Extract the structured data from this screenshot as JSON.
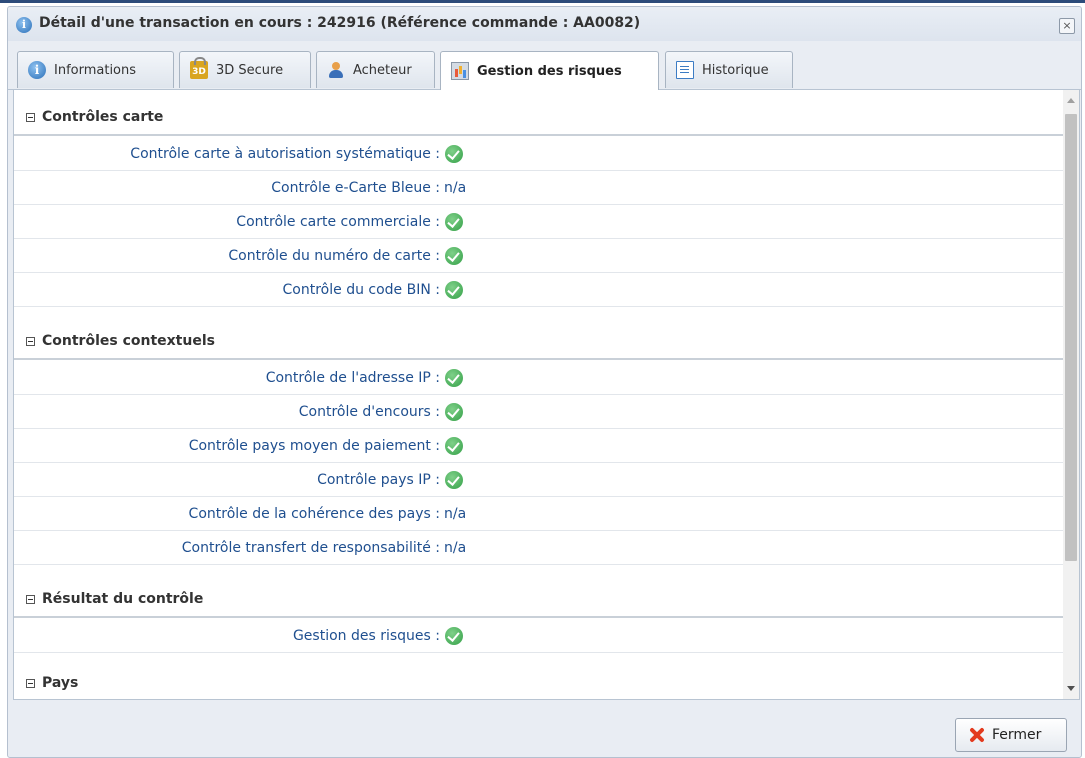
{
  "window": {
    "title": "Détail d'une transaction en cours : 242916 (Référence commande : AA0082)",
    "close_glyph": "×"
  },
  "tabs": [
    {
      "label": "Informations",
      "icon": "info-icon"
    },
    {
      "label": "3D Secure",
      "icon": "lock-3d-icon"
    },
    {
      "label": "Acheteur",
      "icon": "user-icon"
    },
    {
      "label": "Gestion des risques",
      "icon": "chart-icon",
      "active": true
    },
    {
      "label": "Historique",
      "icon": "document-icon"
    }
  ],
  "sections": [
    {
      "title": "Contrôles carte",
      "rows": [
        {
          "label": "Contrôle carte à autorisation systématique :",
          "value": "check"
        },
        {
          "label": "Contrôle e-Carte Bleue :",
          "value": "n/a"
        },
        {
          "label": "Contrôle carte commerciale :",
          "value": "check"
        },
        {
          "label": "Contrôle du numéro de carte :",
          "value": "check"
        },
        {
          "label": "Contrôle du code BIN :",
          "value": "check"
        }
      ]
    },
    {
      "title": "Contrôles contextuels",
      "rows": [
        {
          "label": "Contrôle de l'adresse IP :",
          "value": "check"
        },
        {
          "label": "Contrôle d'encours :",
          "value": "check"
        },
        {
          "label": "Contrôle pays moyen de paiement :",
          "value": "check"
        },
        {
          "label": "Contrôle pays IP :",
          "value": "check"
        },
        {
          "label": "Contrôle de la cohérence des pays :",
          "value": "n/a"
        },
        {
          "label": "Contrôle transfert de responsabilité :",
          "value": "n/a"
        }
      ]
    },
    {
      "title": "Résultat du contrôle",
      "rows": [
        {
          "label": "Gestion des risques :",
          "value": "check"
        }
      ]
    },
    {
      "title": "Pays",
      "rows": []
    }
  ],
  "footer": {
    "close_label": "Fermer"
  },
  "colors": {
    "label": "#1f4f8f",
    "check": "#34a048",
    "close_x": "#e33a1e"
  }
}
